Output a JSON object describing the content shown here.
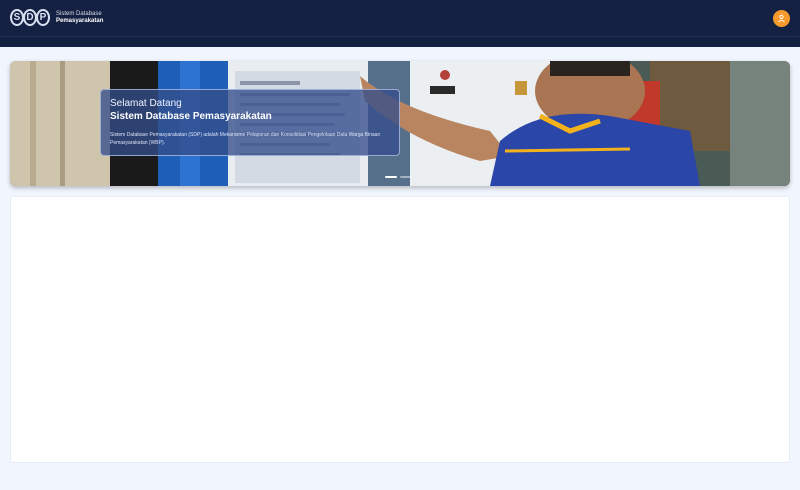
{
  "header": {
    "logo": {
      "letters": [
        "S",
        "D",
        "P"
      ],
      "line1": "Sistem Database",
      "line2": "Pemasyarakatan"
    },
    "user_icon": "user-icon"
  },
  "banner": {
    "kicker": "Selamat Datang",
    "title": "Sistem Database Pemasyarakatan",
    "description": "Sistem Database Pemasyarakatan (SDP) adalah Mekanisme Pelaporan dan Konsolidasi Pengelolaan Data Warga Binaan Pemasyarakatan (WBP).",
    "slides": 2,
    "active_slide": 1
  },
  "colors": {
    "navbar": "#152142",
    "accent": "#f79a2e",
    "background": "#f1f5fd"
  }
}
